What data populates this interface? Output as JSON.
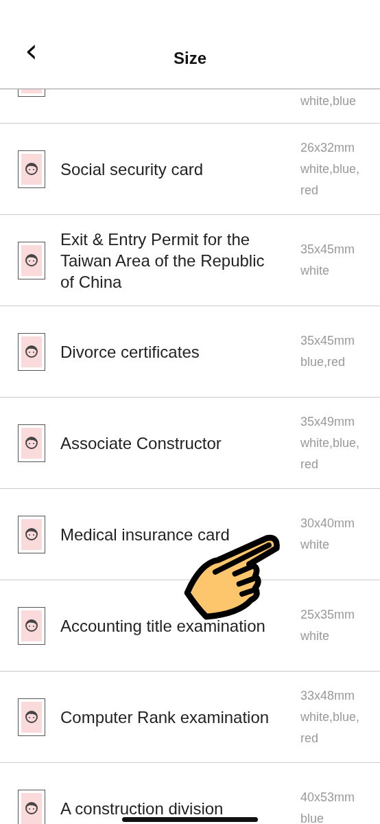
{
  "header": {
    "back": "‹",
    "title": "Size"
  },
  "items": [
    {
      "colors": "white,blue"
    },
    {
      "name": "Social security card",
      "size": "26x32mm",
      "colors": "white,blue,red"
    },
    {
      "name": "Exit & Entry Permit for the Taiwan Area of the Republic of China",
      "size": "35x45mm",
      "colors": "white"
    },
    {
      "name": "Divorce certificates",
      "size": "35x45mm",
      "colors": "blue,red"
    },
    {
      "name": "Associate Constructor",
      "size": "35x49mm",
      "colors": "white,blue,red"
    },
    {
      "name": "Medical insurance card",
      "size": "30x40mm",
      "colors": "white"
    },
    {
      "name": "Accounting title examination",
      "size": "25x35mm",
      "colors": "white"
    },
    {
      "name": "Computer Rank examination",
      "size": "33x48mm",
      "colors": "white,blue,red"
    },
    {
      "name": "A construction division",
      "size": "40x53mm",
      "colors": "blue"
    }
  ]
}
